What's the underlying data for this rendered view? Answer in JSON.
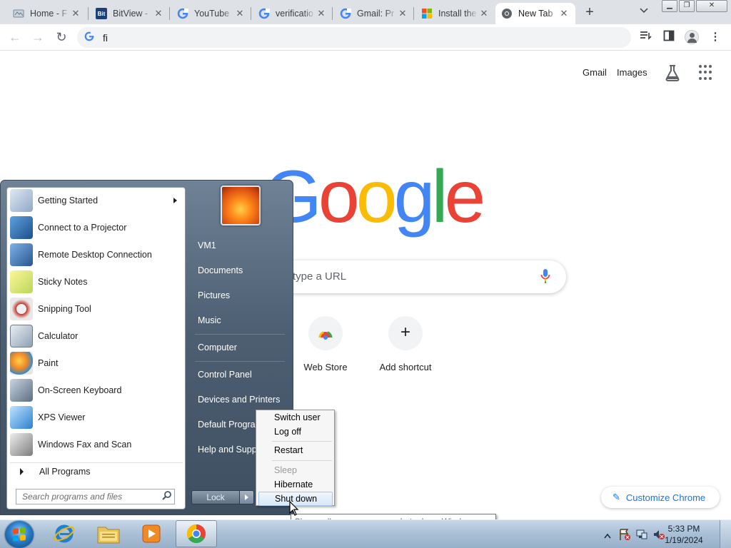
{
  "browser": {
    "tabs": [
      {
        "title": "Home - F",
        "icon": "document-favicon"
      },
      {
        "title": "BitView -",
        "icon": "bitview-favicon"
      },
      {
        "title": "YouTube",
        "icon": "google-favicon"
      },
      {
        "title": "verificatio",
        "icon": "google-favicon"
      },
      {
        "title": "Gmail: Pr",
        "icon": "google-favicon"
      },
      {
        "title": "Install the",
        "icon": "microsoft-favicon"
      },
      {
        "title": "New Tab",
        "icon": "chrome-favicon",
        "active": true
      }
    ],
    "favicon_labels": {
      "bitview": "Bit"
    },
    "omnibox_value": "fi",
    "new_tab_symbol": "+"
  },
  "ntp": {
    "top_links": [
      "Gmail",
      "Images"
    ],
    "logo_letters": [
      "G",
      "o",
      "o",
      "g",
      "l",
      "e"
    ],
    "logo_colors": [
      "#4285f4",
      "#ea4335",
      "#fbbc05",
      "#4285f4",
      "#34a853",
      "#ea4335"
    ],
    "search_placeholder": "type a URL",
    "shortcuts": [
      {
        "label": "Web Store",
        "icon": "web-store-icon"
      },
      {
        "label": "Add shortcut",
        "icon": "plus-icon",
        "symbol": "+"
      }
    ],
    "customize_label": "Customize Chrome"
  },
  "start_menu": {
    "programs": [
      {
        "label": "Getting Started",
        "icon": "getting-started-icon",
        "has_submenu": true
      },
      {
        "label": "Connect to a Projector",
        "icon": "projector-icon"
      },
      {
        "label": "Remote Desktop Connection",
        "icon": "remote-desktop-icon"
      },
      {
        "label": "Sticky Notes",
        "icon": "sticky-notes-icon"
      },
      {
        "label": "Snipping Tool",
        "icon": "snipping-tool-icon"
      },
      {
        "label": "Calculator",
        "icon": "calculator-icon"
      },
      {
        "label": "Paint",
        "icon": "paint-icon"
      },
      {
        "label": "On-Screen Keyboard",
        "icon": "keyboard-icon"
      },
      {
        "label": "XPS Viewer",
        "icon": "xps-viewer-icon"
      },
      {
        "label": "Windows Fax and Scan",
        "icon": "fax-scan-icon"
      }
    ],
    "all_programs": "All Programs",
    "search_placeholder": "Search programs and files",
    "right_items": [
      "VM1",
      "Documents",
      "Pictures",
      "Music",
      "Computer",
      "Control Panel",
      "Devices and Printers",
      "Default Programs",
      "Help and Support"
    ],
    "lock_label": "Lock"
  },
  "power_menu": {
    "items": [
      "Switch user",
      "Log off",
      "Restart",
      "Sleep",
      "Hibernate",
      "Shut down"
    ],
    "disabled": "Sleep",
    "highlighted": "Shut down",
    "tooltip": "Closes all open programs, shuts down Windows, and then turns off your computer."
  },
  "taskbar": {
    "apps": [
      "Internet Explorer",
      "Windows Explorer",
      "Windows Media Player",
      "Google Chrome"
    ],
    "active_app": "Google Chrome",
    "time": "5:33 PM",
    "date": "1/19/2024"
  }
}
